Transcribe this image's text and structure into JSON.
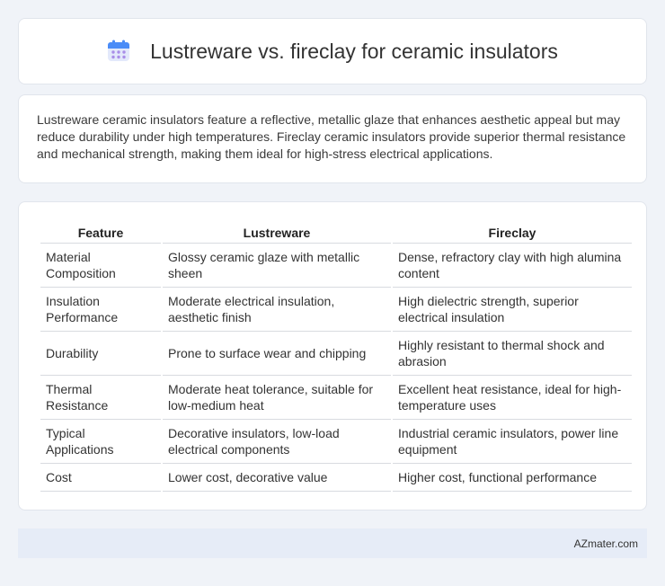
{
  "header": {
    "title": "Lustreware vs. fireclay for ceramic insulators",
    "icon": "calendar-icon",
    "icon_colors": {
      "top": "#4a8cf7",
      "body": "#e3e9fb",
      "dots": "#a98ee8"
    }
  },
  "intro": {
    "text": "Lustreware ceramic insulators feature a reflective, metallic glaze that enhances aesthetic appeal but may reduce durability under high temperatures. Fireclay ceramic insulators provide superior thermal resistance and mechanical strength, making them ideal for high-stress electrical applications."
  },
  "table": {
    "headers": [
      "Feature",
      "Lustreware",
      "Fireclay"
    ],
    "rows": [
      [
        "Material Composition",
        "Glossy ceramic glaze with metallic sheen",
        "Dense, refractory clay with high alumina content"
      ],
      [
        "Insulation Performance",
        "Moderate electrical insulation, aesthetic finish",
        "High dielectric strength, superior electrical insulation"
      ],
      [
        "Durability",
        "Prone to surface wear and chipping",
        "Highly resistant to thermal shock and abrasion"
      ],
      [
        "Thermal Resistance",
        "Moderate heat tolerance, suitable for low-medium heat",
        "Excellent heat resistance, ideal for high-temperature uses"
      ],
      [
        "Typical Applications",
        "Decorative insulators, low-load electrical components",
        "Industrial ceramic insulators, power line equipment"
      ],
      [
        "Cost",
        "Lower cost, decorative value",
        "Higher cost, functional performance"
      ]
    ]
  },
  "footer": {
    "brand": "AZmater.com"
  }
}
